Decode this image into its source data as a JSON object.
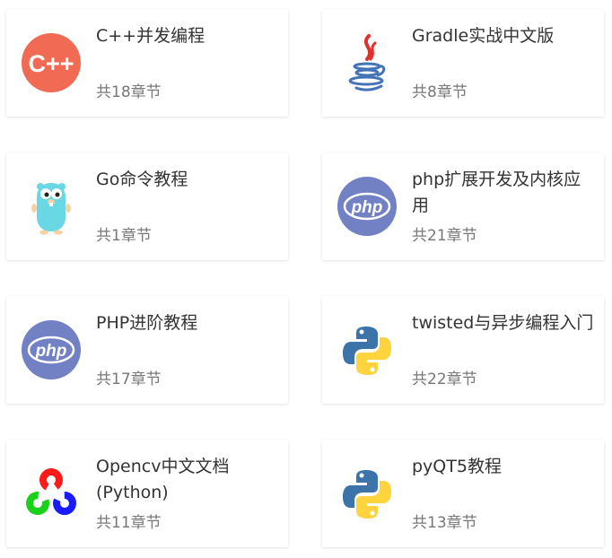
{
  "courses": [
    {
      "title": "C++并发编程",
      "chapters": "共18章节",
      "icon": "cpp-logo-icon",
      "icon_text": "C++"
    },
    {
      "title": "Gradle实战中文版",
      "chapters": "共8章节",
      "icon": "java-logo-icon"
    },
    {
      "title": "Go命令教程",
      "chapters": "共1章节",
      "icon": "go-gopher-icon"
    },
    {
      "title": "php扩展开发及内核应用",
      "chapters": "共21章节",
      "icon": "php-logo-icon",
      "icon_text": "php"
    },
    {
      "title": "PHP进阶教程",
      "chapters": "共17章节",
      "icon": "php-logo-icon",
      "icon_text": "php"
    },
    {
      "title": "twisted与异步编程入门",
      "chapters": "共22章节",
      "icon": "python-logo-icon"
    },
    {
      "title": "Opencv中文文档 (Python)",
      "chapters": "共11章节",
      "icon": "opencv-logo-icon"
    },
    {
      "title": "pyQT5教程",
      "chapters": "共13章节",
      "icon": "python-logo-icon"
    }
  ],
  "colors": {
    "cpp": "#f16a54",
    "php": "#7280c4",
    "python_blue": "#3c73a8",
    "python_yellow": "#fdd33e",
    "java_red": "#e42d2d",
    "java_blue": "#4474b6",
    "go": "#6ad7e5"
  }
}
